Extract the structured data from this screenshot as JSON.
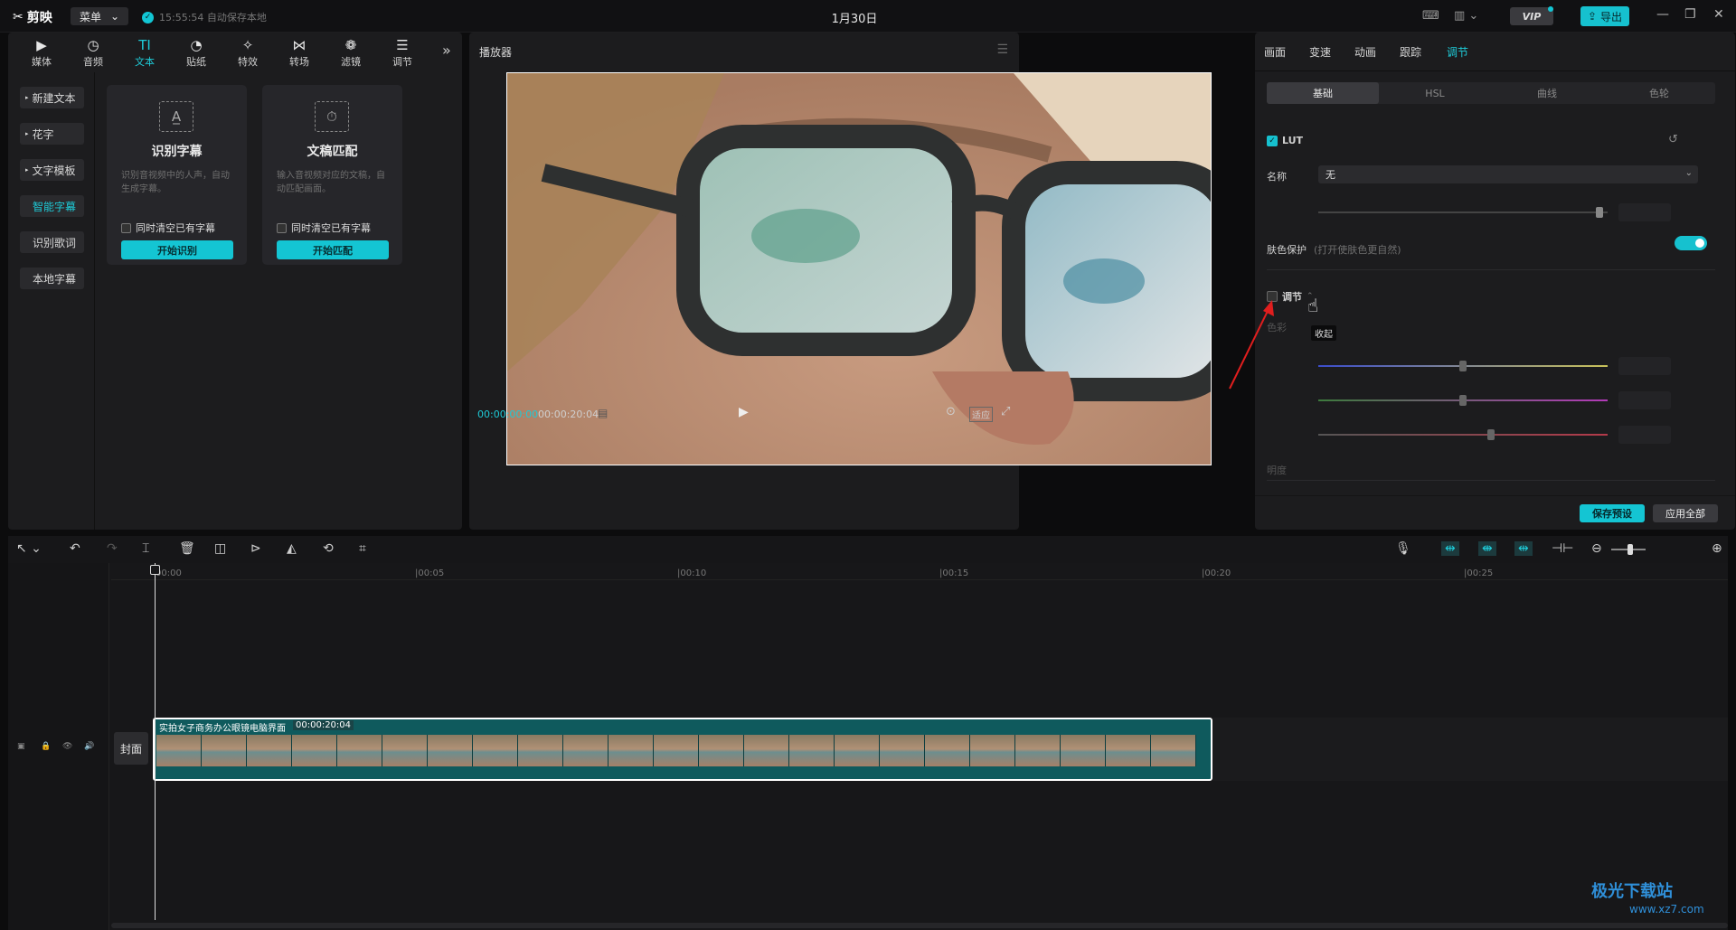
{
  "titlebar": {
    "logo": "剪映",
    "menu_label": "菜单",
    "autosave_text": "15:55:54 自动保存本地",
    "title": "1月30日",
    "vip_label": "VIP",
    "export_label": "导出"
  },
  "left": {
    "tabs": [
      {
        "icon": "▶",
        "label": "媒体"
      },
      {
        "icon": "◷",
        "label": "音频"
      },
      {
        "icon": "TI",
        "label": "文本"
      },
      {
        "icon": "◔",
        "label": "贴纸"
      },
      {
        "icon": "✧",
        "label": "特效"
      },
      {
        "icon": "⋈",
        "label": "转场"
      },
      {
        "icon": "❁",
        "label": "滤镜"
      },
      {
        "icon": "☰",
        "label": "调节"
      }
    ],
    "more": "»",
    "side": [
      "新建文本",
      "花字",
      "文字模板",
      "智能字幕",
      "识别歌词",
      "本地字幕"
    ],
    "cards": [
      {
        "icon": "A̲",
        "title": "识别字幕",
        "desc": "识别音视频中的人声，自动生成字幕。",
        "check": "同时清空已有字幕",
        "button": "开始识别"
      },
      {
        "icon": "⏱",
        "title": "文稿匹配",
        "desc": "输入音视频对应的文稿，自动匹配画面。",
        "check": "同时清空已有字幕",
        "button": "开始匹配"
      }
    ]
  },
  "player": {
    "header": "播放器",
    "time_current": "00:00:00:00",
    "time_total": "00:00:20:04",
    "fit_label": "适应"
  },
  "right": {
    "tabs": [
      "画面",
      "变速",
      "动画",
      "跟踪",
      "调节"
    ],
    "segments": [
      "基础",
      "HSL",
      "曲线",
      "色轮"
    ],
    "lut_label": "LUT",
    "name_label": "名称",
    "name_value": "无",
    "skin_label": "肤色保护",
    "skin_hint": "(打开使肤色更自然)",
    "adjust_label": "调节",
    "color_label": "色彩",
    "brightness_label": "明度",
    "tooltip": "收起",
    "save_preset": "保存预设",
    "apply_all": "应用全部",
    "accent_color": "#16c1cf"
  },
  "timeline": {
    "ticks": [
      "00:00",
      "|00:05",
      "|00:10",
      "|00:15",
      "|00:20",
      "|00:25"
    ],
    "cover_label": "封面",
    "clip_name": "实拍女子商务办公眼镜电脑界面",
    "clip_duration": "00:00:20:04"
  },
  "watermark": {
    "text": "极光下载站",
    "url": "www.xz7.com"
  }
}
